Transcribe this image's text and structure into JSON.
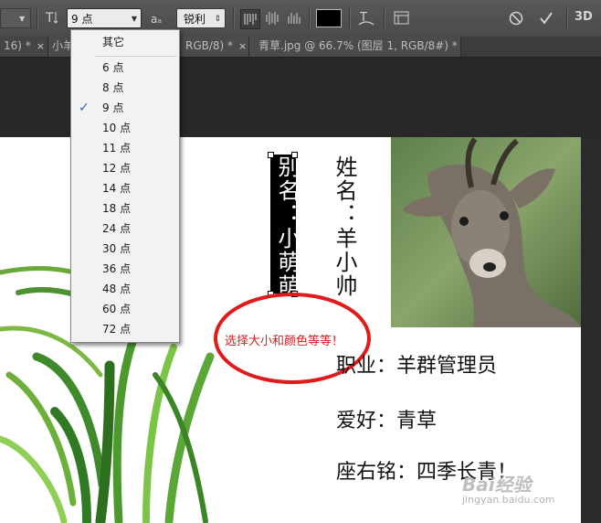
{
  "toolbar": {
    "font_size_value": "9 点",
    "aa_icon": "aₐ",
    "aa_method": "锐利",
    "align_left_icon": "align-left-icon",
    "align_center_icon": "align-center-icon",
    "align_right_icon": "align-right-icon",
    "text_color": "#000000",
    "warp_icon": "warp-text-icon",
    "panels_icon": "panels-icon",
    "cancel_icon": "⃠",
    "commit_icon": "✓",
    "label_3d": "3D"
  },
  "tabs": [
    {
      "label": "16) *",
      "close": "×"
    },
    {
      "label": "小羊",
      "close": ""
    },
    {
      "label": "RGB/8) *",
      "close": "×"
    },
    {
      "label": "青草.jpg @ 66.7% (图层 1, RGB/8#) *",
      "close": "×"
    }
  ],
  "dropdown": {
    "header": "其它",
    "items": [
      {
        "label": "6 点",
        "checked": false
      },
      {
        "label": "8 点",
        "checked": false
      },
      {
        "label": "9 点",
        "checked": true
      },
      {
        "label": "10 点",
        "checked": false
      },
      {
        "label": "11 点",
        "checked": false
      },
      {
        "label": "12 点",
        "checked": false
      },
      {
        "label": "14 点",
        "checked": false
      },
      {
        "label": "18 点",
        "checked": false
      },
      {
        "label": "24 点",
        "checked": false
      },
      {
        "label": "30 点",
        "checked": false
      },
      {
        "label": "36 点",
        "checked": false
      },
      {
        "label": "48 点",
        "checked": false
      },
      {
        "label": "60 点",
        "checked": false
      },
      {
        "label": "72 点",
        "checked": false
      }
    ],
    "check_mark": "✓"
  },
  "card": {
    "alias_text": "别名：小萌萌",
    "name_text": "姓名：羊小帅",
    "annotation": "选择大小和颜色等等！",
    "job": "职业：羊群管理员",
    "hobby": "爱好：青草",
    "motto": "座右铭：四季长青！",
    "annotation_color": "#d42020"
  },
  "watermark": {
    "brand": "Bai经验",
    "url": "jingyan.baidu.com"
  }
}
